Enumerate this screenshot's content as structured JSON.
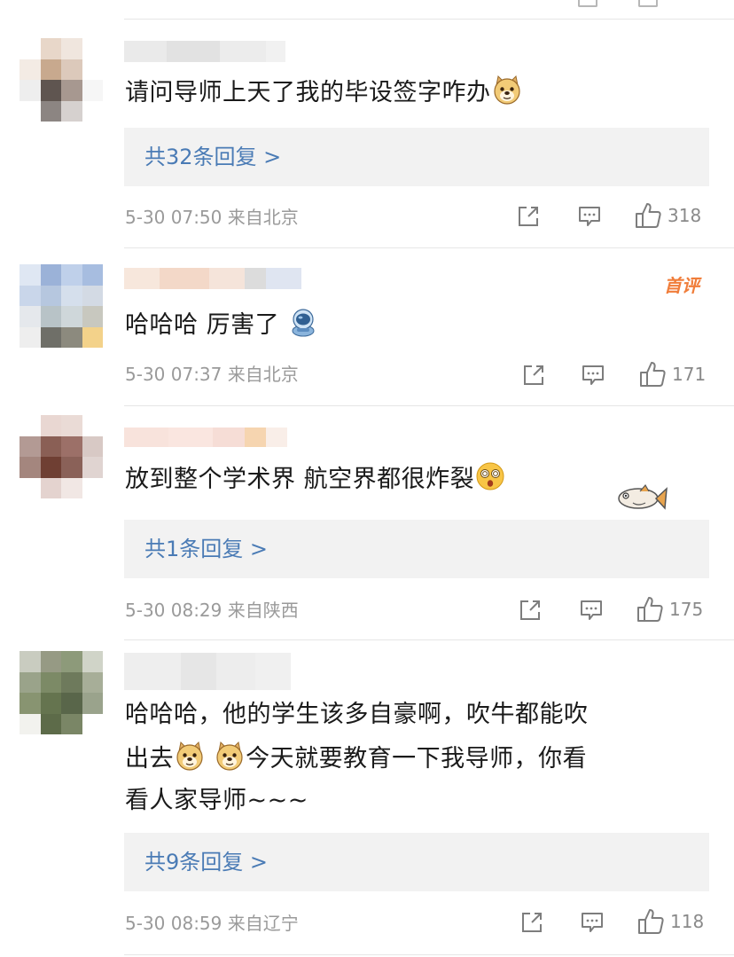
{
  "comments": [
    {
      "text": "请问导师上天了我的毕设签字咋办",
      "emoji": "doge-emoji",
      "reply_label": "共32条回复 >",
      "time": "5-30 07:50",
      "location": "来自北京",
      "likes": "318"
    },
    {
      "badge": "首评",
      "text": "哈哈哈 厉害了",
      "emoji": "astronaut-emoji",
      "time": "5-30 07:37",
      "location": "来自北京",
      "likes": "171"
    },
    {
      "text": "放到整个学术界 航空界都很炸裂",
      "emoji": "dizzy-face-emoji",
      "reply_label": "共1条回复 >",
      "time": "5-30 08:29",
      "location": "来自陕西",
      "likes": "175"
    },
    {
      "line1": "哈哈哈，他的学生该多自豪啊，吹牛都能吹",
      "line2a": "出去",
      "line2b": "今天就要教育一下我导师，你看",
      "line3": "看人家导师~~~",
      "emoji": "doge-emoji",
      "reply_label": "共9条回复 >",
      "time": "5-30 08:59",
      "location": "来自辽宁",
      "likes": "118"
    }
  ],
  "colors": {
    "reply_link": "#4a7bb5",
    "badge": "#f07d3a",
    "meta_text": "#9a9a9a",
    "reply_bg": "#f2f2f2"
  }
}
